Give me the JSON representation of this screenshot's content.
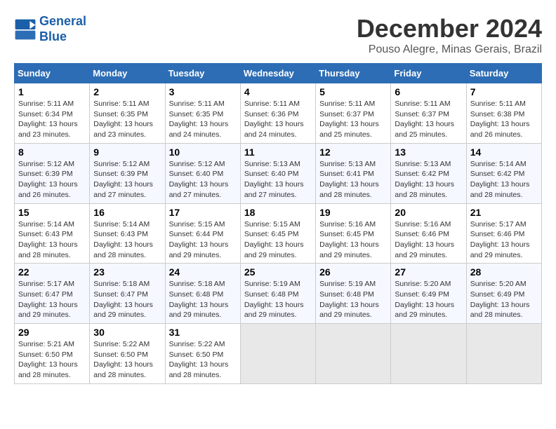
{
  "logo": {
    "line1": "General",
    "line2": "Blue"
  },
  "title": "December 2024",
  "subtitle": "Pouso Alegre, Minas Gerais, Brazil",
  "days_header": [
    "Sunday",
    "Monday",
    "Tuesday",
    "Wednesday",
    "Thursday",
    "Friday",
    "Saturday"
  ],
  "weeks": [
    [
      {
        "day": "1",
        "sunrise": "Sunrise: 5:11 AM",
        "sunset": "Sunset: 6:34 PM",
        "daylight": "Daylight: 13 hours and 23 minutes."
      },
      {
        "day": "2",
        "sunrise": "Sunrise: 5:11 AM",
        "sunset": "Sunset: 6:35 PM",
        "daylight": "Daylight: 13 hours and 23 minutes."
      },
      {
        "day": "3",
        "sunrise": "Sunrise: 5:11 AM",
        "sunset": "Sunset: 6:35 PM",
        "daylight": "Daylight: 13 hours and 24 minutes."
      },
      {
        "day": "4",
        "sunrise": "Sunrise: 5:11 AM",
        "sunset": "Sunset: 6:36 PM",
        "daylight": "Daylight: 13 hours and 24 minutes."
      },
      {
        "day": "5",
        "sunrise": "Sunrise: 5:11 AM",
        "sunset": "Sunset: 6:37 PM",
        "daylight": "Daylight: 13 hours and 25 minutes."
      },
      {
        "day": "6",
        "sunrise": "Sunrise: 5:11 AM",
        "sunset": "Sunset: 6:37 PM",
        "daylight": "Daylight: 13 hours and 25 minutes."
      },
      {
        "day": "7",
        "sunrise": "Sunrise: 5:11 AM",
        "sunset": "Sunset: 6:38 PM",
        "daylight": "Daylight: 13 hours and 26 minutes."
      }
    ],
    [
      {
        "day": "8",
        "sunrise": "Sunrise: 5:12 AM",
        "sunset": "Sunset: 6:39 PM",
        "daylight": "Daylight: 13 hours and 26 minutes."
      },
      {
        "day": "9",
        "sunrise": "Sunrise: 5:12 AM",
        "sunset": "Sunset: 6:39 PM",
        "daylight": "Daylight: 13 hours and 27 minutes."
      },
      {
        "day": "10",
        "sunrise": "Sunrise: 5:12 AM",
        "sunset": "Sunset: 6:40 PM",
        "daylight": "Daylight: 13 hours and 27 minutes."
      },
      {
        "day": "11",
        "sunrise": "Sunrise: 5:13 AM",
        "sunset": "Sunset: 6:40 PM",
        "daylight": "Daylight: 13 hours and 27 minutes."
      },
      {
        "day": "12",
        "sunrise": "Sunrise: 5:13 AM",
        "sunset": "Sunset: 6:41 PM",
        "daylight": "Daylight: 13 hours and 28 minutes."
      },
      {
        "day": "13",
        "sunrise": "Sunrise: 5:13 AM",
        "sunset": "Sunset: 6:42 PM",
        "daylight": "Daylight: 13 hours and 28 minutes."
      },
      {
        "day": "14",
        "sunrise": "Sunrise: 5:14 AM",
        "sunset": "Sunset: 6:42 PM",
        "daylight": "Daylight: 13 hours and 28 minutes."
      }
    ],
    [
      {
        "day": "15",
        "sunrise": "Sunrise: 5:14 AM",
        "sunset": "Sunset: 6:43 PM",
        "daylight": "Daylight: 13 hours and 28 minutes."
      },
      {
        "day": "16",
        "sunrise": "Sunrise: 5:14 AM",
        "sunset": "Sunset: 6:43 PM",
        "daylight": "Daylight: 13 hours and 28 minutes."
      },
      {
        "day": "17",
        "sunrise": "Sunrise: 5:15 AM",
        "sunset": "Sunset: 6:44 PM",
        "daylight": "Daylight: 13 hours and 29 minutes."
      },
      {
        "day": "18",
        "sunrise": "Sunrise: 5:15 AM",
        "sunset": "Sunset: 6:45 PM",
        "daylight": "Daylight: 13 hours and 29 minutes."
      },
      {
        "day": "19",
        "sunrise": "Sunrise: 5:16 AM",
        "sunset": "Sunset: 6:45 PM",
        "daylight": "Daylight: 13 hours and 29 minutes."
      },
      {
        "day": "20",
        "sunrise": "Sunrise: 5:16 AM",
        "sunset": "Sunset: 6:46 PM",
        "daylight": "Daylight: 13 hours and 29 minutes."
      },
      {
        "day": "21",
        "sunrise": "Sunrise: 5:17 AM",
        "sunset": "Sunset: 6:46 PM",
        "daylight": "Daylight: 13 hours and 29 minutes."
      }
    ],
    [
      {
        "day": "22",
        "sunrise": "Sunrise: 5:17 AM",
        "sunset": "Sunset: 6:47 PM",
        "daylight": "Daylight: 13 hours and 29 minutes."
      },
      {
        "day": "23",
        "sunrise": "Sunrise: 5:18 AM",
        "sunset": "Sunset: 6:47 PM",
        "daylight": "Daylight: 13 hours and 29 minutes."
      },
      {
        "day": "24",
        "sunrise": "Sunrise: 5:18 AM",
        "sunset": "Sunset: 6:48 PM",
        "daylight": "Daylight: 13 hours and 29 minutes."
      },
      {
        "day": "25",
        "sunrise": "Sunrise: 5:19 AM",
        "sunset": "Sunset: 6:48 PM",
        "daylight": "Daylight: 13 hours and 29 minutes."
      },
      {
        "day": "26",
        "sunrise": "Sunrise: 5:19 AM",
        "sunset": "Sunset: 6:48 PM",
        "daylight": "Daylight: 13 hours and 29 minutes."
      },
      {
        "day": "27",
        "sunrise": "Sunrise: 5:20 AM",
        "sunset": "Sunset: 6:49 PM",
        "daylight": "Daylight: 13 hours and 29 minutes."
      },
      {
        "day": "28",
        "sunrise": "Sunrise: 5:20 AM",
        "sunset": "Sunset: 6:49 PM",
        "daylight": "Daylight: 13 hours and 28 minutes."
      }
    ],
    [
      {
        "day": "29",
        "sunrise": "Sunrise: 5:21 AM",
        "sunset": "Sunset: 6:50 PM",
        "daylight": "Daylight: 13 hours and 28 minutes."
      },
      {
        "day": "30",
        "sunrise": "Sunrise: 5:22 AM",
        "sunset": "Sunset: 6:50 PM",
        "daylight": "Daylight: 13 hours and 28 minutes."
      },
      {
        "day": "31",
        "sunrise": "Sunrise: 5:22 AM",
        "sunset": "Sunset: 6:50 PM",
        "daylight": "Daylight: 13 hours and 28 minutes."
      },
      null,
      null,
      null,
      null
    ]
  ]
}
